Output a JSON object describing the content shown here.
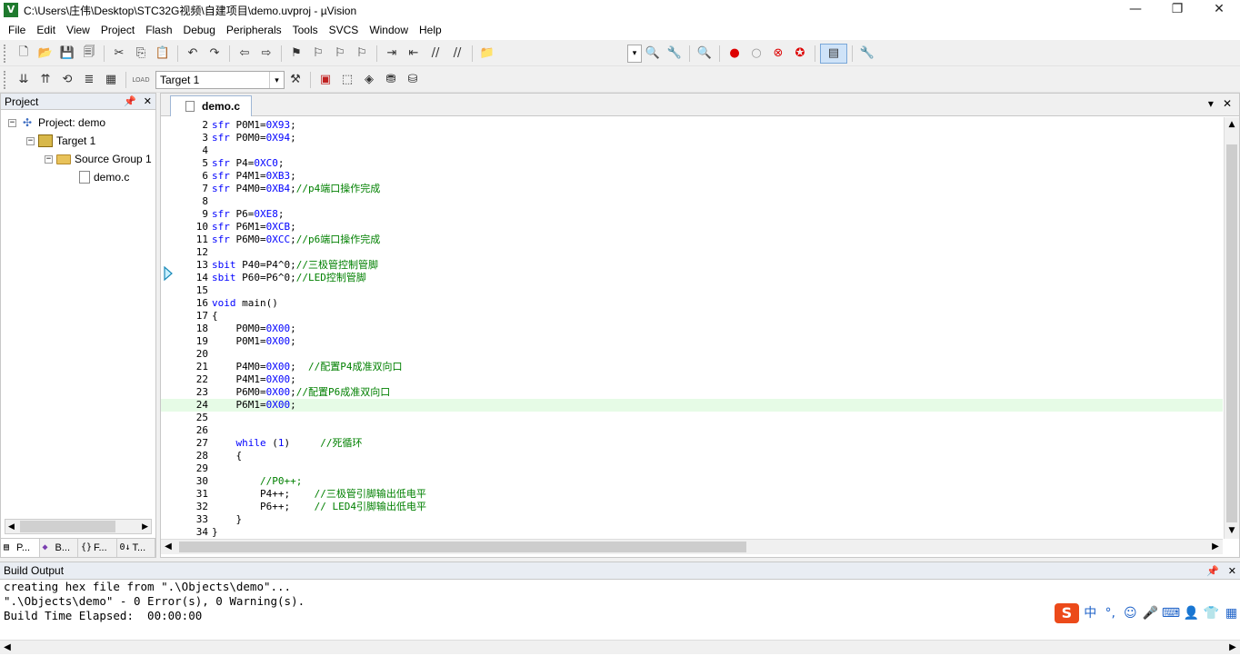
{
  "window": {
    "title": "C:\\Users\\庄伟\\Desktop\\STC32G视频\\自建项目\\demo.uvproj - µVision",
    "app_icon_glyph": "V",
    "minimize_glyph": "—",
    "maximize_glyph": "❐",
    "close_glyph": "✕"
  },
  "menu": [
    "File",
    "Edit",
    "View",
    "Project",
    "Flash",
    "Debug",
    "Peripherals",
    "Tools",
    "SVCS",
    "Window",
    "Help"
  ],
  "toolbar": {
    "target_name": "Target 1",
    "icons": {
      "new": "🗋",
      "open": "📂",
      "save": "💾",
      "save_all": "🗐",
      "cut": "✂",
      "copy": "⎘",
      "paste": "📋",
      "undo": "↶",
      "redo": "↷",
      "back": "⇦",
      "forward": "⇨",
      "bookmark": "⚑",
      "prev_bookmark": "⚐",
      "next_bookmark": "⚐",
      "clear_bookmarks": "⚐",
      "indent": "⇥",
      "unindent": "⇤",
      "comment": "//",
      "uncomment": "//",
      "find_in_files": "📁",
      "find": "🔍",
      "debug": "🔍",
      "breakpoint": "●",
      "disable_bp": "○",
      "kill_bp": "⊗",
      "kill_all_bp": "✪",
      "window_layout": "▤",
      "configure": "🔧",
      "translate": "⇊",
      "build": "⇈",
      "rebuild": "⟲",
      "batch_build": "≣",
      "stop_build": "▦",
      "download": "LOAD",
      "target_options": "⚒",
      "manage_components": "▣",
      "select_packs": "⬚",
      "manage_env": "◈",
      "project_items": "⛃",
      "sw_packs": "⛁"
    }
  },
  "project_panel": {
    "title": "Project",
    "pin_glyph": "📌",
    "close_glyph": "✕",
    "tree": [
      {
        "label": "Project: demo",
        "level": 0,
        "toggle": "−",
        "icon": "project"
      },
      {
        "label": "Target 1",
        "level": 1,
        "toggle": "−",
        "icon": "target"
      },
      {
        "label": "Source Group 1",
        "level": 2,
        "toggle": "−",
        "icon": "folder"
      },
      {
        "label": "demo.c",
        "level": 3,
        "toggle": "",
        "icon": "file"
      }
    ],
    "tabs": [
      {
        "icon": "▤",
        "label": "P..."
      },
      {
        "icon": "◆",
        "label": "B..."
      },
      {
        "icon": "{}",
        "label": "F..."
      },
      {
        "icon": "0↓",
        "label": "T..."
      }
    ]
  },
  "editor": {
    "tab_label": "demo.c",
    "tab_menu_glyph": "▾",
    "tab_close_glyph": "✕",
    "current_line": 24,
    "lines": [
      {
        "n": "2",
        "parts": [
          [
            "kw",
            "sfr"
          ],
          [
            "src",
            " P0M1="
          ],
          [
            "hex",
            "0X93"
          ],
          [
            "src",
            ";"
          ]
        ]
      },
      {
        "n": "3",
        "parts": [
          [
            "kw",
            "sfr"
          ],
          [
            "src",
            " P0M0="
          ],
          [
            "hex",
            "0X94"
          ],
          [
            "src",
            ";"
          ]
        ]
      },
      {
        "n": "4",
        "parts": []
      },
      {
        "n": "5",
        "parts": [
          [
            "kw",
            "sfr"
          ],
          [
            "src",
            " P4="
          ],
          [
            "hex",
            "0XC0"
          ],
          [
            "src",
            ";"
          ]
        ]
      },
      {
        "n": "6",
        "parts": [
          [
            "kw",
            "sfr"
          ],
          [
            "src",
            " P4M1="
          ],
          [
            "hex",
            "0XB3"
          ],
          [
            "src",
            ";"
          ]
        ]
      },
      {
        "n": "7",
        "parts": [
          [
            "kw",
            "sfr"
          ],
          [
            "src",
            " P4M0="
          ],
          [
            "hex",
            "0XB4"
          ],
          [
            "src",
            ";"
          ],
          [
            "cm",
            "//p4端口操作完成"
          ]
        ]
      },
      {
        "n": "8",
        "parts": []
      },
      {
        "n": "9",
        "parts": [
          [
            "kw",
            "sfr"
          ],
          [
            "src",
            " P6="
          ],
          [
            "hex",
            "0XE8"
          ],
          [
            "src",
            ";"
          ]
        ]
      },
      {
        "n": "10",
        "parts": [
          [
            "kw",
            "sfr"
          ],
          [
            "src",
            " P6M1="
          ],
          [
            "hex",
            "0XCB"
          ],
          [
            "src",
            ";"
          ]
        ]
      },
      {
        "n": "11",
        "parts": [
          [
            "kw",
            "sfr"
          ],
          [
            "src",
            " P6M0="
          ],
          [
            "hex",
            "0XCC"
          ],
          [
            "src",
            ";"
          ],
          [
            "cm",
            "//p6端口操作完成"
          ]
        ]
      },
      {
        "n": "12",
        "parts": []
      },
      {
        "n": "13",
        "parts": [
          [
            "kw",
            "sbit"
          ],
          [
            "src",
            " P40=P4^0;"
          ],
          [
            "cm",
            "//三极管控制管脚"
          ]
        ]
      },
      {
        "n": "14",
        "parts": [
          [
            "kw",
            "sbit"
          ],
          [
            "src",
            " P60=P6^0;"
          ],
          [
            "cm",
            "//LED控制管脚"
          ]
        ]
      },
      {
        "n": "15",
        "parts": []
      },
      {
        "n": "16",
        "parts": [
          [
            "kw",
            "void"
          ],
          [
            "src",
            " main()"
          ]
        ]
      },
      {
        "n": "17",
        "parts": [
          [
            "src",
            "{"
          ]
        ]
      },
      {
        "n": "18",
        "parts": [
          [
            "src",
            "    P0M0="
          ],
          [
            "hex",
            "0X00"
          ],
          [
            "src",
            ";"
          ]
        ]
      },
      {
        "n": "19",
        "parts": [
          [
            "src",
            "    P0M1="
          ],
          [
            "hex",
            "0X00"
          ],
          [
            "src",
            ";"
          ]
        ]
      },
      {
        "n": "20",
        "parts": []
      },
      {
        "n": "21",
        "parts": [
          [
            "src",
            "    P4M0="
          ],
          [
            "hex",
            "0X00"
          ],
          [
            "src",
            ";  "
          ],
          [
            "cm",
            "//配置P4成准双向口"
          ]
        ]
      },
      {
        "n": "22",
        "parts": [
          [
            "src",
            "    P4M1="
          ],
          [
            "hex",
            "0X00"
          ],
          [
            "src",
            ";"
          ]
        ]
      },
      {
        "n": "23",
        "parts": [
          [
            "src",
            "    P6M0="
          ],
          [
            "hex",
            "0X00"
          ],
          [
            "src",
            ";"
          ],
          [
            "cm",
            "//配置P6成准双向口"
          ]
        ]
      },
      {
        "n": "24",
        "parts": [
          [
            "src",
            "    P6M1="
          ],
          [
            "hex",
            "0X00"
          ],
          [
            "src",
            ";"
          ]
        ]
      },
      {
        "n": "25",
        "parts": []
      },
      {
        "n": "26",
        "parts": []
      },
      {
        "n": "27",
        "parts": [
          [
            "src",
            "    "
          ],
          [
            "kw",
            "while"
          ],
          [
            "src",
            " ("
          ],
          [
            "hex",
            "1"
          ],
          [
            "src",
            ")     "
          ],
          [
            "cm",
            "//死循环"
          ]
        ]
      },
      {
        "n": "28",
        "parts": [
          [
            "src",
            "    {"
          ]
        ]
      },
      {
        "n": "29",
        "parts": []
      },
      {
        "n": "30",
        "parts": [
          [
            "src",
            "        "
          ],
          [
            "cm",
            "//P0++;"
          ]
        ]
      },
      {
        "n": "31",
        "parts": [
          [
            "src",
            "        P4++;    "
          ],
          [
            "cm",
            "//三极管引脚输出低电平"
          ]
        ]
      },
      {
        "n": "32",
        "parts": [
          [
            "src",
            "        P6++;    "
          ],
          [
            "cm",
            "// LED4引脚输出低电平"
          ]
        ]
      },
      {
        "n": "33",
        "parts": [
          [
            "src",
            "    }"
          ]
        ]
      },
      {
        "n": "34",
        "parts": [
          [
            "src",
            "}"
          ]
        ]
      }
    ]
  },
  "build_output": {
    "title": "Build Output",
    "pin_glyph": "📌",
    "close_glyph": "✕",
    "lines": [
      "creating hex file from \".\\Objects\\demo\"...",
      "\".\\Objects\\demo\" - 0 Error(s), 0 Warning(s).",
      "Build Time Elapsed:  00:00:00"
    ]
  },
  "ime": {
    "logo": "S",
    "items": [
      "中",
      "°,",
      "☺",
      "🎤",
      "⌨",
      "👤",
      "👕",
      "▦"
    ]
  },
  "colors": {
    "keyword": "#0000ff",
    "comment": "#008000",
    "current_line_bg": "#e6fbe6",
    "panel_header_bg": "#e9edf3",
    "ime_logo_bg": "#ec4a1a"
  }
}
